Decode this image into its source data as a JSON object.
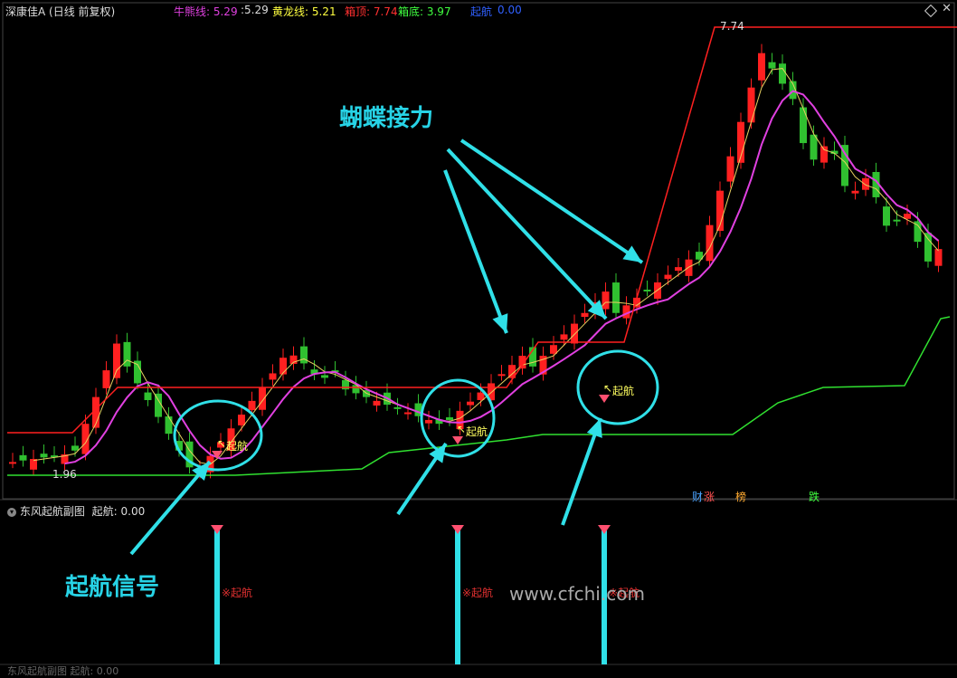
{
  "window": {
    "title": "深康佳A (日线 前复权)"
  },
  "indicators": [
    {
      "label": "牛熊线: 5.29",
      "color": "#e040e0"
    },
    {
      "label": ":5.29",
      "color": "#dddddd"
    },
    {
      "label": "黄龙线: 5.21",
      "color": "#ffff40"
    },
    {
      "label": "箱顶: 7.74",
      "color": "#ff3030"
    },
    {
      "label": "箱底: 3.97",
      "color": "#40ff40"
    },
    {
      "label": "起航",
      "color": "#3060ff"
    },
    {
      "label": "0.00",
      "color": "#3060ff"
    }
  ],
  "price_labels": {
    "high": "7.74",
    "low": "1.96"
  },
  "signal_label": "起航",
  "signal_arrow": "↖",
  "sub_panel": {
    "title": "东风起航副图",
    "value_label": "起航: 0.00",
    "signal_text": "※起航"
  },
  "bottom_panel": {
    "title": "东风起航副图",
    "value_label": "起航: 0.00"
  },
  "badges": [
    {
      "text": "财",
      "color": "#4aa3ff"
    },
    {
      "text": "涨",
      "color": "#ff5050"
    },
    {
      "text": "榜",
      "color": "#ffaa30"
    },
    {
      "text": "跌",
      "color": "#40ff40"
    }
  ],
  "annotations": {
    "butterfly": "蝴蝶接力",
    "signal": "起航信号"
  },
  "watermark": "www.cfchi.com",
  "colors": {
    "up": "#ff2020",
    "down": "#30c030",
    "ma_yellow": "#e8d060",
    "bull_bear": "#e040e0",
    "box_top": "#ff2020",
    "box_bottom": "#30e030",
    "cyan": "#30e0e8"
  }
}
